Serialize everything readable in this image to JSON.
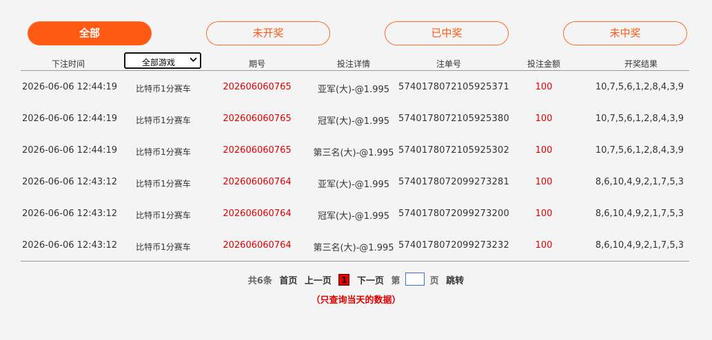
{
  "tabs": [
    {
      "label": "全部",
      "active": true
    },
    {
      "label": "未开奖",
      "active": false
    },
    {
      "label": "已中奖",
      "active": false
    },
    {
      "label": "未中奖",
      "active": false
    }
  ],
  "table": {
    "headers": {
      "time": "下注时间",
      "game_select": "全部游戏",
      "issue": "期号",
      "detail": "投注详情",
      "order_no": "注单号",
      "amount": "投注金额",
      "result": "开奖结果"
    },
    "rows": [
      {
        "time": "2026-06-06 12:44:19",
        "game": "比特币1分赛车",
        "issue": "202606060765",
        "detail": "亚军(大)-@1.995",
        "order_no": "5740178072105925371",
        "amount": "100",
        "result": "10,7,5,6,1,2,8,4,3,9"
      },
      {
        "time": "2026-06-06 12:44:19",
        "game": "比特币1分赛车",
        "issue": "202606060765",
        "detail": "冠军(大)-@1.995",
        "order_no": "5740178072105925380",
        "amount": "100",
        "result": "10,7,5,6,1,2,8,4,3,9"
      },
      {
        "time": "2026-06-06 12:44:19",
        "game": "比特币1分赛车",
        "issue": "202606060765",
        "detail": "第三名(大)-@1.995",
        "order_no": "5740178072105925302",
        "amount": "100",
        "result": "10,7,5,6,1,2,8,4,3,9"
      },
      {
        "time": "2026-06-06 12:43:12",
        "game": "比特币1分赛车",
        "issue": "202606060764",
        "detail": "亚军(大)-@1.995",
        "order_no": "5740178072099273281",
        "amount": "100",
        "result": "8,6,10,4,9,2,1,7,5,3"
      },
      {
        "time": "2026-06-06 12:43:12",
        "game": "比特币1分赛车",
        "issue": "202606060764",
        "detail": "冠军(大)-@1.995",
        "order_no": "5740178072099273200",
        "amount": "100",
        "result": "8,6,10,4,9,2,1,7,5,3"
      },
      {
        "time": "2026-06-06 12:43:12",
        "game": "比特币1分赛车",
        "issue": "202606060764",
        "detail": "第三名(大)-@1.995",
        "order_no": "5740178072099273232",
        "amount": "100",
        "result": "8,6,10,4,9,2,1,7,5,3"
      }
    ]
  },
  "pager": {
    "total": "共6条",
    "first": "首页",
    "prev": "上一页",
    "current": "1",
    "next": "下一页",
    "goto_prefix": "第",
    "goto_input_value": "",
    "goto_suffix": "页",
    "jump": "跳转"
  },
  "note": "（只查询当天的数据）",
  "colors": {
    "accent": "#ff5a14",
    "highlight_red": "#e00000",
    "background": "#f5f4f4"
  }
}
